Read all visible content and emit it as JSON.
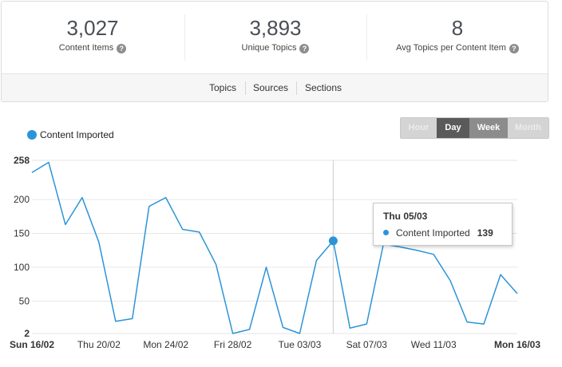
{
  "stats": [
    {
      "value": "3,027",
      "label": "Content Items"
    },
    {
      "value": "3,893",
      "label": "Unique Topics"
    },
    {
      "value": "8",
      "label": "Avg Topics per Content Item"
    }
  ],
  "help_glyph": "?",
  "tabs": [
    {
      "label": "Topics"
    },
    {
      "label": "Sources"
    },
    {
      "label": "Sections"
    }
  ],
  "range_buttons": [
    {
      "label": "Hour",
      "state": "disabled"
    },
    {
      "label": "Day",
      "state": "active"
    },
    {
      "label": "Week",
      "state": "selected"
    },
    {
      "label": "Month",
      "state": "disabled"
    }
  ],
  "colors": {
    "series": "#2b94d8",
    "grid": "#e6e6e6",
    "crosshair": "#cccccc"
  },
  "tooltip": {
    "title": "Thu 05/03",
    "series_name": "Content Imported",
    "value": "139"
  },
  "chart_data": {
    "type": "line",
    "series": [
      {
        "name": "Content Imported",
        "x": [
          "16/02",
          "17/02",
          "18/02",
          "19/02",
          "20/02",
          "21/02",
          "22/02",
          "23/02",
          "24/02",
          "25/02",
          "26/02",
          "27/02",
          "28/02",
          "29/02",
          "01/03",
          "02/03",
          "03/03",
          "04/03",
          "05/03",
          "06/03",
          "07/03",
          "08/03",
          "09/03",
          "10/03",
          "11/03",
          "12/03",
          "13/03",
          "14/03",
          "15/03",
          "16/03"
        ],
        "values": [
          240,
          255,
          163,
          203,
          137,
          20,
          24,
          190,
          203,
          156,
          152,
          104,
          2,
          8,
          100,
          11,
          2,
          110,
          139,
          10,
          16,
          134,
          130,
          125,
          119,
          80,
          19,
          16,
          89,
          61
        ]
      }
    ],
    "highlight_index": 18,
    "y_ticks": [
      2,
      50,
      100,
      150,
      200,
      258
    ],
    "y_bold_ticks": [
      2,
      258
    ],
    "ylim": [
      2,
      258
    ],
    "x_ticks": [
      {
        "label": "Sun 16/02",
        "index": 0,
        "bold": true
      },
      {
        "label": "Thu 20/02",
        "index": 4,
        "bold": false
      },
      {
        "label": "Mon 24/02",
        "index": 8,
        "bold": false
      },
      {
        "label": "Fri 28/02",
        "index": 12,
        "bold": false
      },
      {
        "label": "Tue 03/03",
        "index": 16,
        "bold": false
      },
      {
        "label": "Sat 07/03",
        "index": 20,
        "bold": false
      },
      {
        "label": "Wed 11/03",
        "index": 24,
        "bold": false
      },
      {
        "label": "Mon 16/03",
        "index": 29,
        "bold": true
      }
    ],
    "legend_position": "top-left",
    "grid": true
  }
}
